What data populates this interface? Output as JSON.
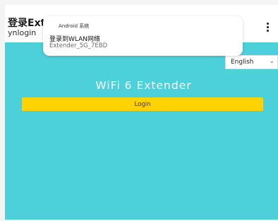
{
  "app_bar": {
    "title": "登录Extender_5G_7EBD",
    "subtitle": "ynlogin",
    "menu_icon": "more-vertical-icon"
  },
  "notification": {
    "app_name": "Android 系统",
    "title": "登录到WLAN网络",
    "text": "Extender_5G_7EBD"
  },
  "content": {
    "background": "#4cd0da",
    "language_select": {
      "value": "English",
      "icon": "chevron-down-icon"
    },
    "heading": "WiFi 6 Extender",
    "login_label": "Login",
    "login_color": "#ffd200"
  }
}
